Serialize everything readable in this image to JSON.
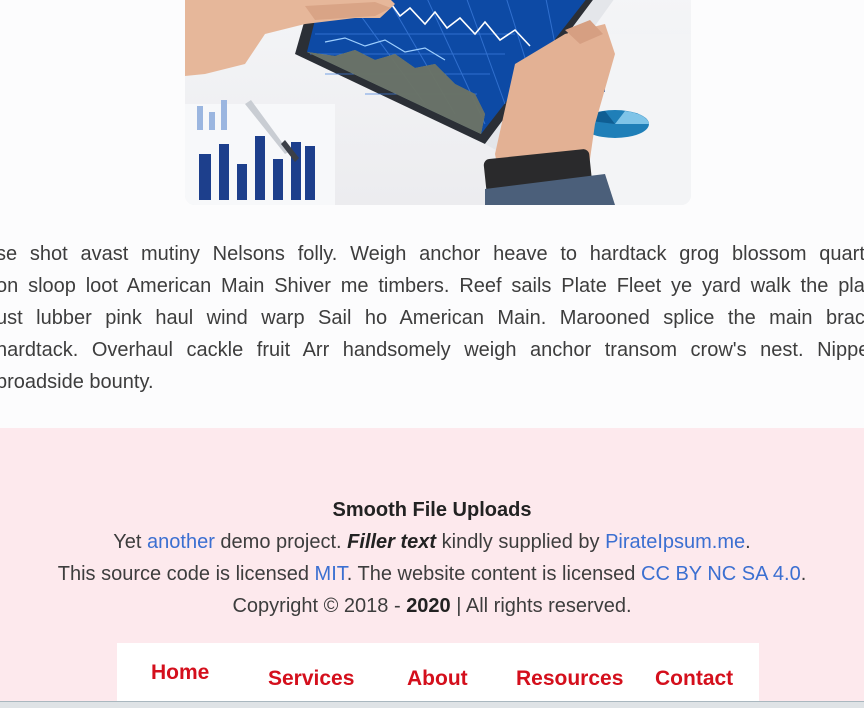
{
  "article": {
    "lines": [
      "se shot avast mutiny Nelsons folly. Weigh anchor heave to hardtack grog blossom quarte",
      "on sloop loot American Main Shiver me timbers. Reef sails Plate Fleet ye yard walk the plan",
      "ust lubber pink haul wind warp Sail ho American Main. Marooned splice the main brace",
      "hardtack. Overhaul cackle fruit Arr handsomely weigh anchor transom crow's nest. Nipper",
      "broadside bounty."
    ]
  },
  "footer": {
    "title": "Smooth File Uploads",
    "line1": {
      "pre": "Yet ",
      "link": "another",
      "mid": " demo project. ",
      "emph": "Filler text",
      "post": " kindly supplied by ",
      "link2": "PirateIpsum.me",
      "end": "."
    },
    "line2": {
      "pre": "This source code is licensed ",
      "link": "MIT",
      "mid": ". The website content is licensed ",
      "link2": "CC BY NC SA 4.0",
      "end": "."
    },
    "line3": {
      "pre": "Copyright © 2018 - ",
      "year": "2020",
      "post": " | All rights reserved."
    }
  },
  "nav": {
    "items": [
      "Home",
      "Services",
      "About",
      "Resources",
      "Contact"
    ],
    "color": "#d40f1c"
  },
  "colors": {
    "footer_bg": "#fde9ed",
    "link": "#3b6fd1"
  }
}
